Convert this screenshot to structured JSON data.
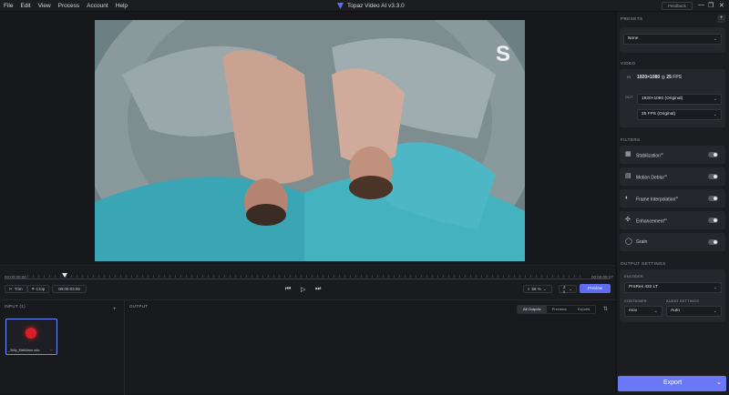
{
  "menu": [
    "File",
    "Edit",
    "View",
    "Process",
    "Account",
    "Help"
  ],
  "app_title": "Topaz Video AI  v3.3.0",
  "feedback_label": "Feedback",
  "window_controls": {
    "minimize": "—",
    "maximize": "❐",
    "close": "✕"
  },
  "timeline": {
    "start_time": "00:00:00:00",
    "end_time": "00:00:09:17",
    "trim_label": "Trim",
    "crop_label": "Crop",
    "current_time": "00:00:03:06",
    "zoom_value": "55 %",
    "speed_value": "2 x",
    "preview_label": "Preview"
  },
  "input_panel": {
    "title": "INPUT (1)",
    "add": "+",
    "file_name": "_360p_MeltWave.mkv",
    "more": "⋯"
  },
  "output_panel": {
    "title": "OUTPUT",
    "tabs": [
      "All Outputs",
      "Previews",
      "Exports"
    ],
    "active_tab": 0,
    "sort_icon": "⇅"
  },
  "sidebar": {
    "presets_title": "PRESETS",
    "preset_value": "None",
    "video_title": "VIDEO",
    "video_in_tag": "IN",
    "video_out_tag": "OUT",
    "video_in_res": "1920×1080",
    "video_in_fps": "25",
    "video_in_fps_unit": "FPS",
    "video_out_res": "1920×1080 (Original)",
    "video_out_fps": "25 FPS (Original)",
    "filters_title": "FILTERS",
    "filters": [
      {
        "label": "Stabilization",
        "sup": "AI",
        "icon": "stabilization-icon",
        "glyph": "▦"
      },
      {
        "label": "Motion Deblur",
        "sup": "AI",
        "icon": "motion-deblur-icon",
        "glyph": "▤"
      },
      {
        "label": "Frame Interpolation",
        "sup": "AI",
        "icon": "frame-interpolation-icon",
        "glyph": "◐"
      },
      {
        "label": "Enhancement",
        "sup": "AI",
        "icon": "enhancement-icon",
        "glyph": "✣"
      },
      {
        "label": "Grain",
        "sup": "",
        "icon": "grain-icon",
        "glyph": "◯"
      }
    ],
    "output_title": "OUTPUT SETTINGS",
    "encoder_label": "ENCODER",
    "encoder_value": "ProRes 422 LT",
    "container_label": "CONTAINER",
    "container_value": "mov",
    "audio_label": "AUDIO SETTINGS",
    "audio_value": "Auto",
    "export_label": "Export"
  },
  "colors": {
    "accent": "#5e6cf2",
    "background": "#16171b",
    "panel": "#1c1d21",
    "card": "#25272c"
  }
}
